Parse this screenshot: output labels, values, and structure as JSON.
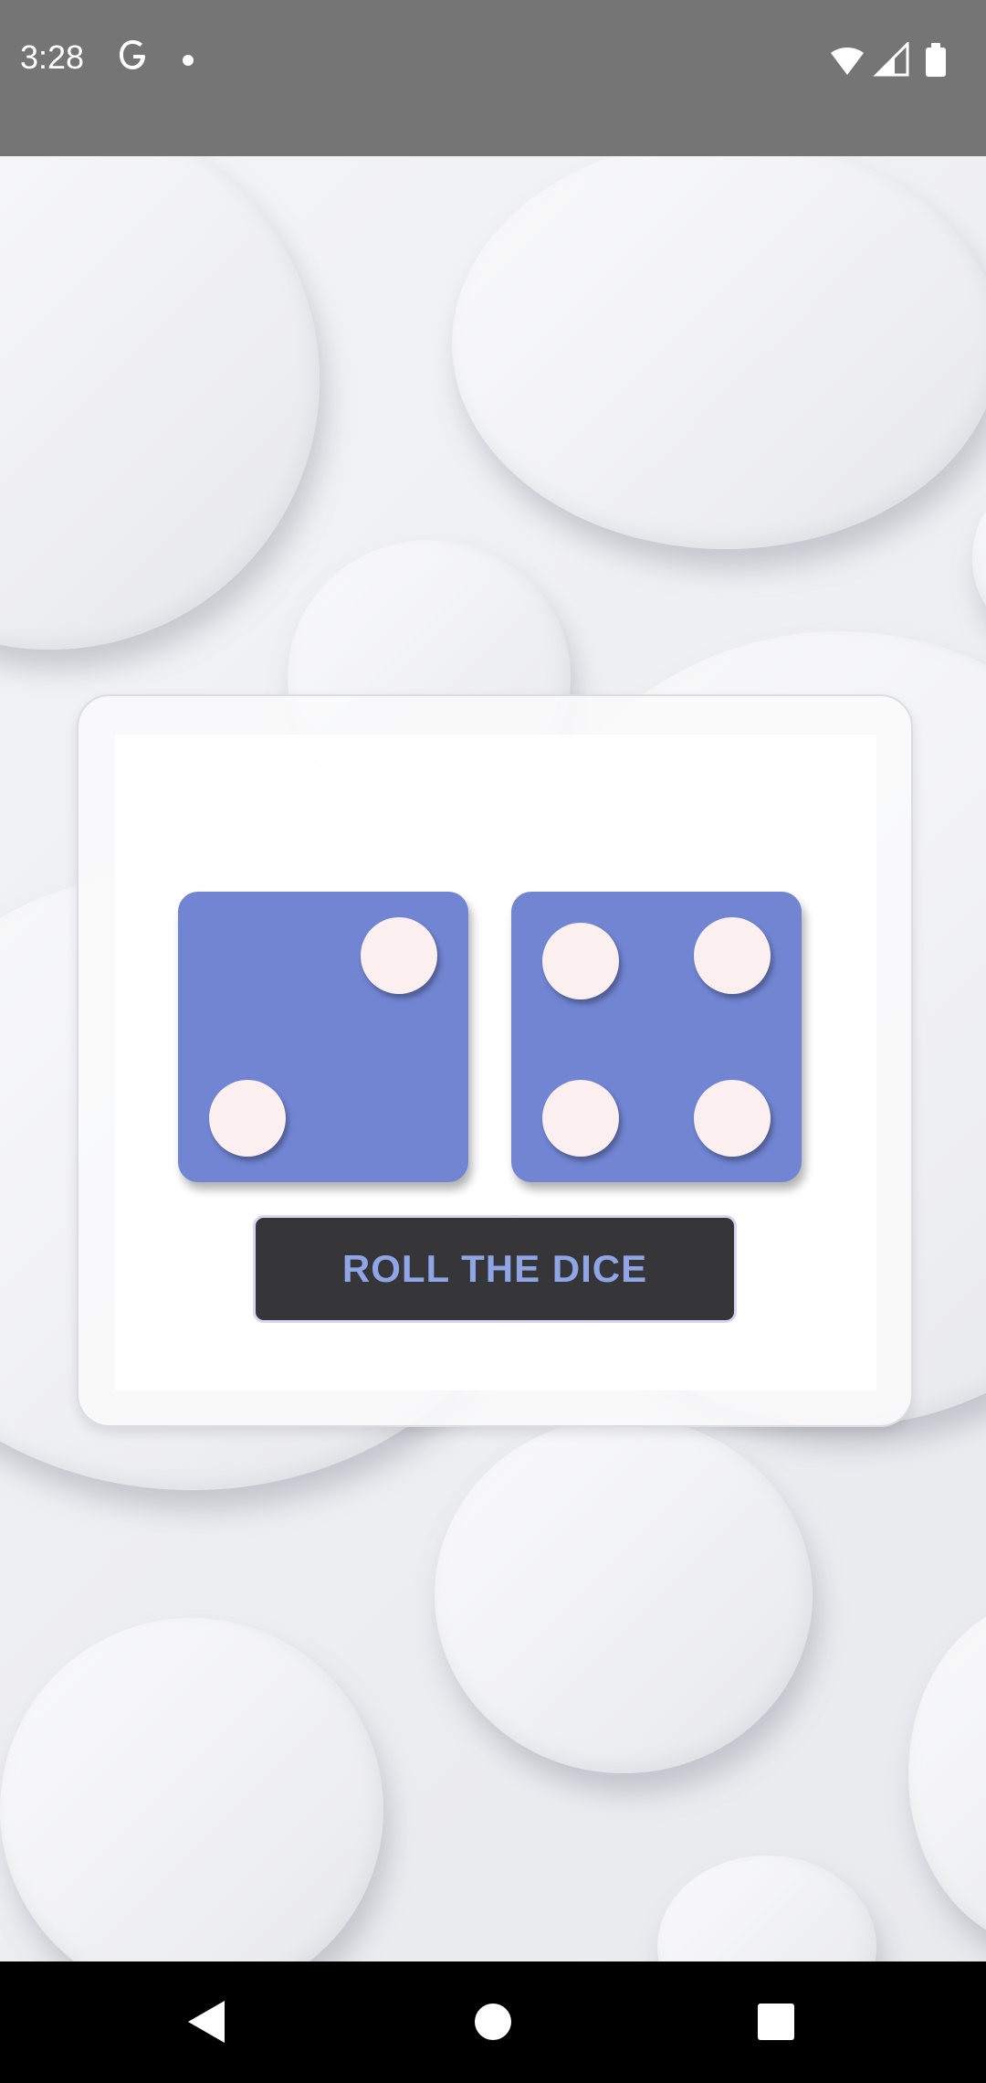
{
  "status_bar": {
    "time": "3:28",
    "icons": [
      "google-icon",
      "notification-dot-icon",
      "wifi-icon",
      "signal-icon",
      "battery-icon"
    ]
  },
  "dice": [
    {
      "value": 2,
      "color": "#7185d3",
      "pip_color": "#fbefef"
    },
    {
      "value": 4,
      "color": "#7185d3",
      "pip_color": "#fbefef"
    }
  ],
  "button": {
    "label": "ROLL THE DICE",
    "background": "#363537",
    "text_color": "#8fa5e6"
  },
  "nav_bar": {
    "buttons": [
      "back-icon",
      "home-icon",
      "recents-icon"
    ]
  }
}
